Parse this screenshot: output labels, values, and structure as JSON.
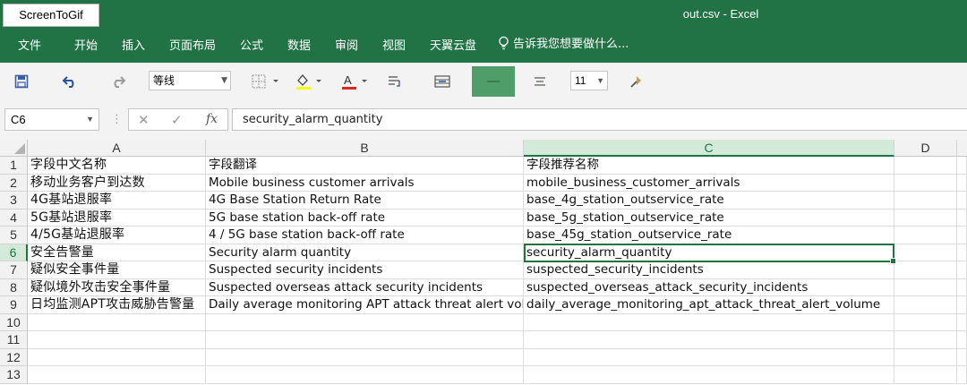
{
  "overlay_label": "ScreenToGif",
  "window_title": "out.csv - Excel",
  "menu": [
    "文件",
    "开始",
    "插入",
    "页面布局",
    "公式",
    "数据",
    "审阅",
    "视图",
    "天翼云盘"
  ],
  "tell_me": "告诉我您想要做什么...",
  "toolbar": {
    "font_name": "等线",
    "font_size": "11",
    "icons": [
      "save-icon",
      "undo-icon",
      "redo-icon",
      "borders-icon",
      "fill-color-icon",
      "font-color-icon",
      "wrap-text-icon",
      "merge-icon",
      "align-center-icon",
      "align-left-icon",
      "format-painter-icon"
    ],
    "fill_color": "#ffff00",
    "font_color": "#e0261d"
  },
  "formula_bar": {
    "name_box": "C6",
    "content": "security_alarm_quantity",
    "fx": "fx"
  },
  "columns": [
    "A",
    "B",
    "C",
    "D"
  ],
  "selected_column": "C",
  "selected_row": "6",
  "rows": [
    {
      "num": "1",
      "cells": [
        "字段中文名称",
        "字段翻译",
        "字段推荐名称"
      ]
    },
    {
      "num": "2",
      "cells": [
        "移动业务客户到达数",
        "Mobile business customer arrivals",
        "mobile_business_customer_arrivals"
      ]
    },
    {
      "num": "3",
      "cells": [
        "4G基站退服率",
        "4G Base Station Return Rate",
        "base_4g_station_outservice_rate"
      ]
    },
    {
      "num": "4",
      "cells": [
        "5G基站退服率",
        "5G base station back-off rate",
        "base_5g_station_outservice_rate"
      ]
    },
    {
      "num": "5",
      "cells": [
        "4/5G基站退服率",
        "4 / 5G base station back-off rate",
        "base_45g_station_outservice_rate"
      ]
    },
    {
      "num": "6",
      "cells": [
        "安全告警量",
        "Security alarm quantity",
        "security_alarm_quantity"
      ]
    },
    {
      "num": "7",
      "cells": [
        "疑似安全事件量",
        "Suspected security incidents",
        "suspected_security_incidents"
      ]
    },
    {
      "num": "8",
      "cells": [
        "疑似境外攻击安全事件量",
        "Suspected overseas attack security incidents",
        "suspected_overseas_attack_security_incidents"
      ]
    },
    {
      "num": "9",
      "cells": [
        "日均监测APT攻击威胁告警量",
        "Daily average monitoring APT attack threat alert volume",
        "daily_average_monitoring_apt_attack_threat_alert_volume"
      ]
    },
    {
      "num": "10",
      "cells": [
        "",
        "",
        ""
      ]
    },
    {
      "num": "11",
      "cells": [
        "",
        "",
        ""
      ]
    },
    {
      "num": "12",
      "cells": [
        "",
        "",
        ""
      ]
    },
    {
      "num": "13",
      "cells": [
        "",
        "",
        ""
      ]
    }
  ],
  "accent_color": "#217346"
}
